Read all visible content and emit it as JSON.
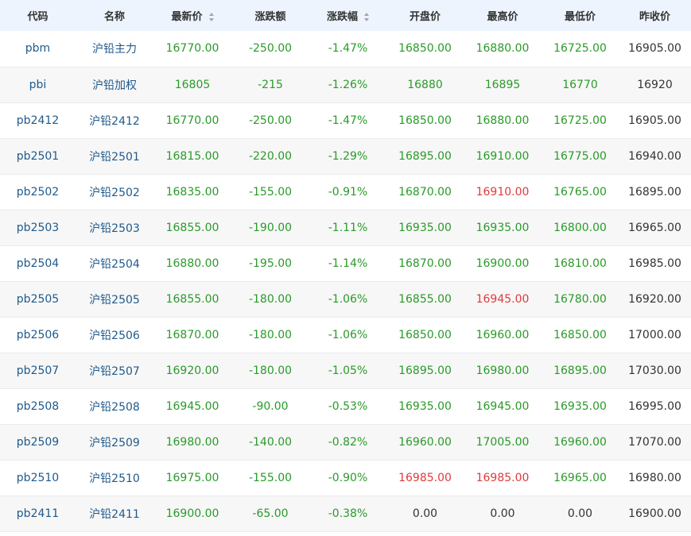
{
  "colors": {
    "header_bg": "#edf4fd",
    "link": "#1f5a8c",
    "down": "#2a9a2a",
    "up": "#e03a3a",
    "flat": "#333333"
  },
  "header": {
    "code": "代码",
    "name": "名称",
    "last": "最新价",
    "change": "涨跌额",
    "change_pct": "涨跌幅",
    "open": "开盘价",
    "high": "最高价",
    "low": "最低价",
    "prev_close": "昨收价"
  },
  "rows": [
    {
      "code": "pbm",
      "name": "沪铅主力",
      "last": "16770.00",
      "change": "-250.00",
      "change_pct": "-1.47%",
      "open": "16850.00",
      "high": "16880.00",
      "low": "16725.00",
      "prev_close": "16905.00",
      "open_color": "green",
      "high_color": "green",
      "low_color": "green"
    },
    {
      "code": "pbi",
      "name": "沪铅加权",
      "last": "16805",
      "change": "-215",
      "change_pct": "-1.26%",
      "open": "16880",
      "high": "16895",
      "low": "16770",
      "prev_close": "16920",
      "open_color": "green",
      "high_color": "green",
      "low_color": "green"
    },
    {
      "code": "pb2412",
      "name": "沪铅2412",
      "last": "16770.00",
      "change": "-250.00",
      "change_pct": "-1.47%",
      "open": "16850.00",
      "high": "16880.00",
      "low": "16725.00",
      "prev_close": "16905.00",
      "open_color": "green",
      "high_color": "green",
      "low_color": "green"
    },
    {
      "code": "pb2501",
      "name": "沪铅2501",
      "last": "16815.00",
      "change": "-220.00",
      "change_pct": "-1.29%",
      "open": "16895.00",
      "high": "16910.00",
      "low": "16775.00",
      "prev_close": "16940.00",
      "open_color": "green",
      "high_color": "green",
      "low_color": "green"
    },
    {
      "code": "pb2502",
      "name": "沪铅2502",
      "last": "16835.00",
      "change": "-155.00",
      "change_pct": "-0.91%",
      "open": "16870.00",
      "high": "16910.00",
      "low": "16765.00",
      "prev_close": "16895.00",
      "open_color": "green",
      "high_color": "red",
      "low_color": "green"
    },
    {
      "code": "pb2503",
      "name": "沪铅2503",
      "last": "16855.00",
      "change": "-190.00",
      "change_pct": "-1.11%",
      "open": "16935.00",
      "high": "16935.00",
      "low": "16800.00",
      "prev_close": "16965.00",
      "open_color": "green",
      "high_color": "green",
      "low_color": "green"
    },
    {
      "code": "pb2504",
      "name": "沪铅2504",
      "last": "16880.00",
      "change": "-195.00",
      "change_pct": "-1.14%",
      "open": "16870.00",
      "high": "16900.00",
      "low": "16810.00",
      "prev_close": "16985.00",
      "open_color": "green",
      "high_color": "green",
      "low_color": "green"
    },
    {
      "code": "pb2505",
      "name": "沪铅2505",
      "last": "16855.00",
      "change": "-180.00",
      "change_pct": "-1.06%",
      "open": "16855.00",
      "high": "16945.00",
      "low": "16780.00",
      "prev_close": "16920.00",
      "open_color": "green",
      "high_color": "red",
      "low_color": "green"
    },
    {
      "code": "pb2506",
      "name": "沪铅2506",
      "last": "16870.00",
      "change": "-180.00",
      "change_pct": "-1.06%",
      "open": "16850.00",
      "high": "16960.00",
      "low": "16850.00",
      "prev_close": "17000.00",
      "open_color": "green",
      "high_color": "green",
      "low_color": "green"
    },
    {
      "code": "pb2507",
      "name": "沪铅2507",
      "last": "16920.00",
      "change": "-180.00",
      "change_pct": "-1.05%",
      "open": "16895.00",
      "high": "16980.00",
      "low": "16895.00",
      "prev_close": "17030.00",
      "open_color": "green",
      "high_color": "green",
      "low_color": "green"
    },
    {
      "code": "pb2508",
      "name": "沪铅2508",
      "last": "16945.00",
      "change": "-90.00",
      "change_pct": "-0.53%",
      "open": "16935.00",
      "high": "16945.00",
      "low": "16935.00",
      "prev_close": "16995.00",
      "open_color": "green",
      "high_color": "green",
      "low_color": "green"
    },
    {
      "code": "pb2509",
      "name": "沪铅2509",
      "last": "16980.00",
      "change": "-140.00",
      "change_pct": "-0.82%",
      "open": "16960.00",
      "high": "17005.00",
      "low": "16960.00",
      "prev_close": "17070.00",
      "open_color": "green",
      "high_color": "green",
      "low_color": "green"
    },
    {
      "code": "pb2510",
      "name": "沪铅2510",
      "last": "16975.00",
      "change": "-155.00",
      "change_pct": "-0.90%",
      "open": "16985.00",
      "high": "16985.00",
      "low": "16965.00",
      "prev_close": "16980.00",
      "open_color": "red",
      "high_color": "red",
      "low_color": "green"
    },
    {
      "code": "pb2411",
      "name": "沪铅2411",
      "last": "16900.00",
      "change": "-65.00",
      "change_pct": "-0.38%",
      "open": "0.00",
      "high": "0.00",
      "low": "0.00",
      "prev_close": "16900.00",
      "open_color": "dark",
      "high_color": "dark",
      "low_color": "dark"
    }
  ]
}
